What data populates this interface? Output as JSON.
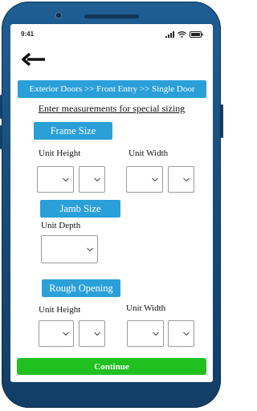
{
  "status_bar": {
    "time": "9:41"
  },
  "breadcrumb": "Exterior Doors >> Front Entry >> Single Door",
  "subtitle": "Enter measurements for special sizing",
  "frame_size": {
    "heading": "Frame Size",
    "unit_height_label": "Unit Height",
    "unit_width_label": "Unit Width"
  },
  "jamb_size": {
    "heading": "Jamb Size",
    "unit_depth_label": "Unit Depth"
  },
  "rough_opening": {
    "heading": "Rough Opening",
    "unit_height_label": "Unit Height",
    "unit_width_label": "Unit Width"
  },
  "continue_label": "Continue",
  "colors": {
    "accent": "#2a9fd8",
    "continue": "#20c020",
    "phone_frame": "#1a5486"
  },
  "icons": [
    "back-arrow-icon",
    "signal-icon",
    "wifi-icon",
    "battery-icon",
    "chevron-down-icon"
  ]
}
